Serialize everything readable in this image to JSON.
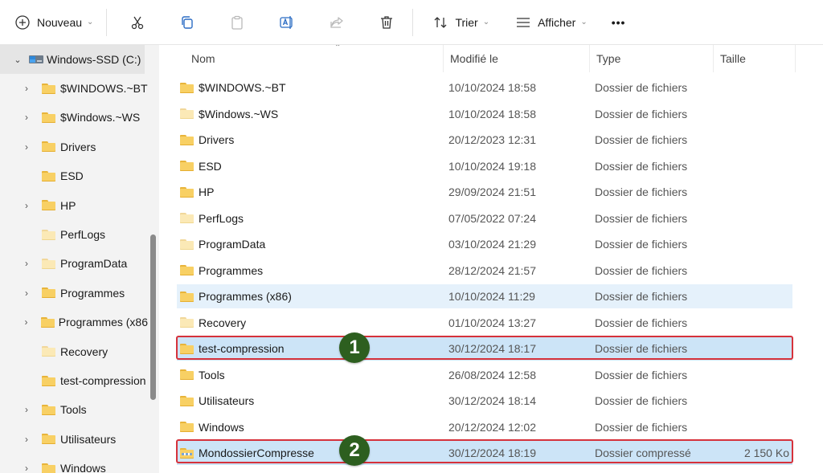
{
  "toolbar": {
    "new_label": "Nouveau",
    "sort_label": "Trier",
    "view_label": "Afficher",
    "more_label": "•••"
  },
  "sidebar": {
    "drive_label": "Windows-SSD (C:)",
    "items": [
      {
        "label": "$WINDOWS.~BT",
        "expandable": true,
        "light": false
      },
      {
        "label": "$Windows.~WS",
        "expandable": true,
        "light": false
      },
      {
        "label": "Drivers",
        "expandable": true,
        "light": false
      },
      {
        "label": "ESD",
        "expandable": false,
        "light": false
      },
      {
        "label": "HP",
        "expandable": true,
        "light": false
      },
      {
        "label": "PerfLogs",
        "expandable": false,
        "light": true
      },
      {
        "label": "ProgramData",
        "expandable": true,
        "light": true
      },
      {
        "label": "Programmes",
        "expandable": true,
        "light": false
      },
      {
        "label": "Programmes (x86",
        "expandable": true,
        "light": false
      },
      {
        "label": "Recovery",
        "expandable": false,
        "light": true
      },
      {
        "label": "test-compression",
        "expandable": false,
        "light": false
      },
      {
        "label": "Tools",
        "expandable": true,
        "light": false
      },
      {
        "label": "Utilisateurs",
        "expandable": true,
        "light": false
      },
      {
        "label": "Windows",
        "expandable": true,
        "light": false
      }
    ]
  },
  "columns": {
    "name": "Nom",
    "modified": "Modifié le",
    "type": "Type",
    "size": "Taille"
  },
  "files": [
    {
      "name": "$WINDOWS.~BT",
      "date": "10/10/2024 18:58",
      "type": "Dossier de fichiers",
      "size": "",
      "icon": "folder-icon"
    },
    {
      "name": "$Windows.~WS",
      "date": "10/10/2024 18:58",
      "type": "Dossier de fichiers",
      "size": "",
      "icon": "folder-icon-light"
    },
    {
      "name": "Drivers",
      "date": "20/12/2023 12:31",
      "type": "Dossier de fichiers",
      "size": "",
      "icon": "folder-icon"
    },
    {
      "name": "ESD",
      "date": "10/10/2024 19:18",
      "type": "Dossier de fichiers",
      "size": "",
      "icon": "folder-icon"
    },
    {
      "name": "HP",
      "date": "29/09/2024 21:51",
      "type": "Dossier de fichiers",
      "size": "",
      "icon": "folder-icon"
    },
    {
      "name": "PerfLogs",
      "date": "07/05/2022 07:24",
      "type": "Dossier de fichiers",
      "size": "",
      "icon": "folder-icon-light"
    },
    {
      "name": "ProgramData",
      "date": "03/10/2024 21:29",
      "type": "Dossier de fichiers",
      "size": "",
      "icon": "folder-icon-light"
    },
    {
      "name": "Programmes",
      "date": "28/12/2024 21:57",
      "type": "Dossier de fichiers",
      "size": "",
      "icon": "folder-icon"
    },
    {
      "name": "Programmes (x86)",
      "date": "10/10/2024 11:29",
      "type": "Dossier de fichiers",
      "size": "",
      "icon": "folder-icon"
    },
    {
      "name": "Recovery",
      "date": "01/10/2024 13:27",
      "type": "Dossier de fichiers",
      "size": "",
      "icon": "folder-icon-light"
    },
    {
      "name": "test-compression",
      "date": "30/12/2024 18:17",
      "type": "Dossier de fichiers",
      "size": "",
      "icon": "folder-icon"
    },
    {
      "name": "Tools",
      "date": "26/08/2024 12:58",
      "type": "Dossier de fichiers",
      "size": "",
      "icon": "folder-icon"
    },
    {
      "name": "Utilisateurs",
      "date": "30/12/2024 18:14",
      "type": "Dossier de fichiers",
      "size": "",
      "icon": "folder-icon"
    },
    {
      "name": "Windows",
      "date": "20/12/2024 12:02",
      "type": "Dossier de fichiers",
      "size": "",
      "icon": "folder-icon"
    },
    {
      "name": "MondossierCompresse",
      "date": "30/12/2024 18:19",
      "type": "Dossier compressé",
      "size": "2 150 Ko",
      "icon": "zip-folder-icon"
    }
  ],
  "annotations": {
    "badge_1": "1",
    "badge_2": "2",
    "annotation_color": "#d6323b",
    "badge_color": "#2d5f1f"
  },
  "colors": {
    "selection": "#cce4f7",
    "hover": "#e5f1fb",
    "sidebar_bg": "#f3f3f3"
  }
}
